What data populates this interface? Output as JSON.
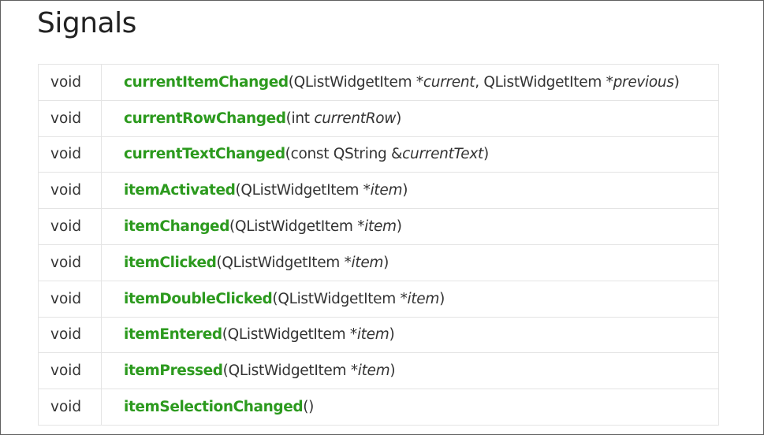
{
  "section_title": "Signals",
  "signals": [
    {
      "return_type": "void",
      "name": "currentItemChanged",
      "params": [
        {
          "text": "(QListWidgetItem *",
          "italic": false
        },
        {
          "text": "current",
          "italic": true
        },
        {
          "text": ", QListWidgetItem *",
          "italic": false
        },
        {
          "text": "previous",
          "italic": true
        },
        {
          "text": ")",
          "italic": false
        }
      ]
    },
    {
      "return_type": "void",
      "name": "currentRowChanged",
      "params": [
        {
          "text": "(int ",
          "italic": false
        },
        {
          "text": "currentRow",
          "italic": true
        },
        {
          "text": ")",
          "italic": false
        }
      ]
    },
    {
      "return_type": "void",
      "name": "currentTextChanged",
      "params": [
        {
          "text": "(const QString &",
          "italic": false
        },
        {
          "text": "currentText",
          "italic": true
        },
        {
          "text": ")",
          "italic": false
        }
      ]
    },
    {
      "return_type": "void",
      "name": "itemActivated",
      "params": [
        {
          "text": "(QListWidgetItem *",
          "italic": false
        },
        {
          "text": "item",
          "italic": true
        },
        {
          "text": ")",
          "italic": false
        }
      ]
    },
    {
      "return_type": "void",
      "name": "itemChanged",
      "params": [
        {
          "text": "(QListWidgetItem *",
          "italic": false
        },
        {
          "text": "item",
          "italic": true
        },
        {
          "text": ")",
          "italic": false
        }
      ]
    },
    {
      "return_type": "void",
      "name": "itemClicked",
      "params": [
        {
          "text": "(QListWidgetItem *",
          "italic": false
        },
        {
          "text": "item",
          "italic": true
        },
        {
          "text": ")",
          "italic": false
        }
      ]
    },
    {
      "return_type": "void",
      "name": "itemDoubleClicked",
      "params": [
        {
          "text": "(QListWidgetItem *",
          "italic": false
        },
        {
          "text": "item",
          "italic": true
        },
        {
          "text": ")",
          "italic": false
        }
      ]
    },
    {
      "return_type": "void",
      "name": "itemEntered",
      "params": [
        {
          "text": "(QListWidgetItem *",
          "italic": false
        },
        {
          "text": "item",
          "italic": true
        },
        {
          "text": ")",
          "italic": false
        }
      ]
    },
    {
      "return_type": "void",
      "name": "itemPressed",
      "params": [
        {
          "text": "(QListWidgetItem *",
          "italic": false
        },
        {
          "text": "item",
          "italic": true
        },
        {
          "text": ")",
          "italic": false
        }
      ]
    },
    {
      "return_type": "void",
      "name": "itemSelectionChanged",
      "params": [
        {
          "text": "()",
          "italic": false
        }
      ]
    }
  ],
  "colors": {
    "link": "#2c9a1e",
    "text": "#333333",
    "border": "#e4e4e4"
  }
}
